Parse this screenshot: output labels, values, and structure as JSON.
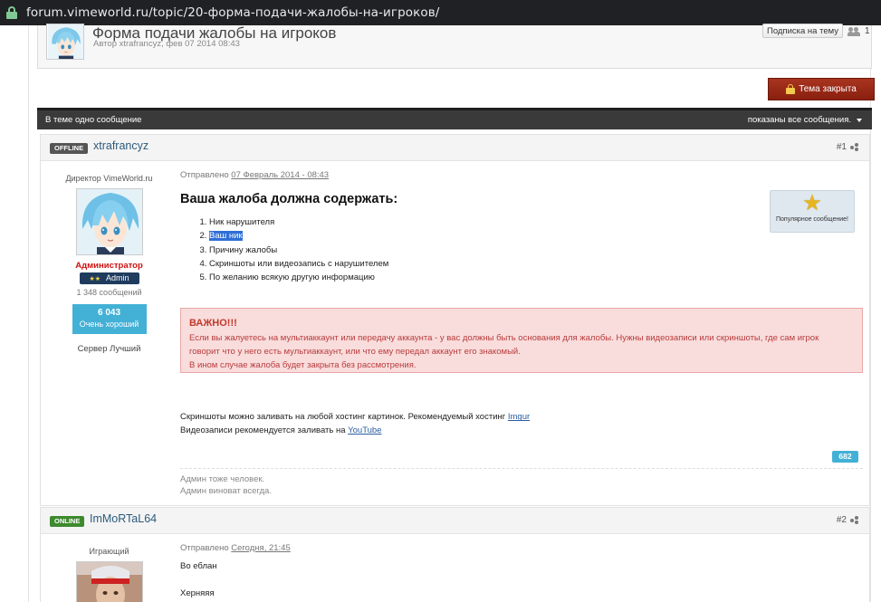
{
  "browser": {
    "url": "forum.vimeworld.ru/topic/20-форма-подачи-жалобы-на-игроков/"
  },
  "topic": {
    "title": "Форма подачи жалобы на игроков",
    "meta": "Автор xtrafrancyz, фев 07 2014 08:43",
    "subscribe_label": "Подписка на тему",
    "followers": "1",
    "locked_label": "Тема закрыта"
  },
  "bar": {
    "left": "В теме одно сообщение",
    "right": "показаны все сообщения."
  },
  "post1": {
    "status": "OFFLINE",
    "username": "xtrafrancyz",
    "number": "#1",
    "author_title": "Директор VimeWorld.ru",
    "role": "Администратор",
    "rank": "Admin",
    "message_count": "1 348 сообщений",
    "reputation_value": "6 043",
    "reputation_label": "Очень хороший",
    "server_rank": "Сервер Лучший",
    "posted_prefix": "Отправлено",
    "posted_date": "07 Февраль 2014 - 08:43",
    "popular_label": "Популярное сообщение!",
    "heading": "Ваша жалоба должна содержать:",
    "items": [
      "Ник нарушителя",
      "Ваш ник",
      "Причину жалобы",
      "Скриншоты или видеозапись с нарушителем",
      "По желанию всякую другую информацию"
    ],
    "warning_title": "ВАЖНО!!!",
    "warning_line1": "Если вы жалуетесь на мультиаккаунт или передачу аккаунта - у вас должны быть основания для жалобы. Нужны видеозаписи или скриншоты, где сам игрок",
    "warning_line2": "говорит что у него есть мультиаккаунт, или что ему передал аккаунт его знакомый.",
    "warning_line3": "В ином случае жалоба будет закрыта без рассмотрения.",
    "text1": "Скриншоты можно заливать на любой хостинг картинок. Рекомендуемый хостинг ",
    "link1": "Imgur",
    "text2": "Видеозаписи рекомендуется заливать на ",
    "link2": "YouTube",
    "rep_count": "682",
    "signature1": "Админ тоже человек.",
    "signature2": "Админ виноват всегда."
  },
  "post2": {
    "status": "ONLINE",
    "username": "ImMoRTaL64",
    "number": "#2",
    "author_title": "Играющий",
    "posted_prefix": "Отправлено",
    "posted_date": "Сегодня, 21:45",
    "line1": "Во еблан",
    "line2": "Херняяя"
  },
  "colors": {
    "locked_button": "#8a1f0f",
    "reputation": "#43b0d6",
    "warning_bg": "#f9dcdc",
    "admin_role": "#d01010"
  },
  "icons": [
    "lock-icon",
    "people-icon",
    "padlock-icon",
    "caret-down-icon",
    "share-icon",
    "star-icon"
  ]
}
